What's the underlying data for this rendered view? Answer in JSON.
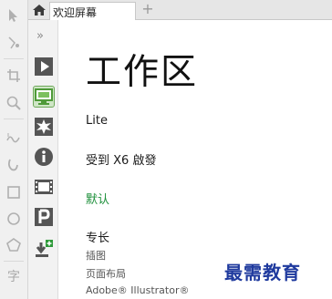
{
  "tab": {
    "title": "欢迎屏幕",
    "add_label": "+"
  },
  "docker": {
    "collapse_label": "»"
  },
  "toolbox": {
    "text_tool_label": "字"
  },
  "workspace": {
    "title": "工作区",
    "items": [
      {
        "label": "Lite",
        "color": "#1a1a1a"
      },
      {
        "label": "受到 X6 啟發",
        "color": "#1a1a1a"
      },
      {
        "label": "默认",
        "color": "#1d8f3a"
      },
      {
        "label": "专长",
        "color": "#1a1a1a"
      }
    ],
    "sub_items": [
      "插图",
      "页面布局",
      "Adobe® Illustrator®"
    ]
  },
  "watermark": {
    "text": "最需教育",
    "color": "#1f3a9e"
  },
  "accent": {
    "active_tab_bg": "#cfe6c6",
    "active_tab_border": "#6ea85a"
  }
}
